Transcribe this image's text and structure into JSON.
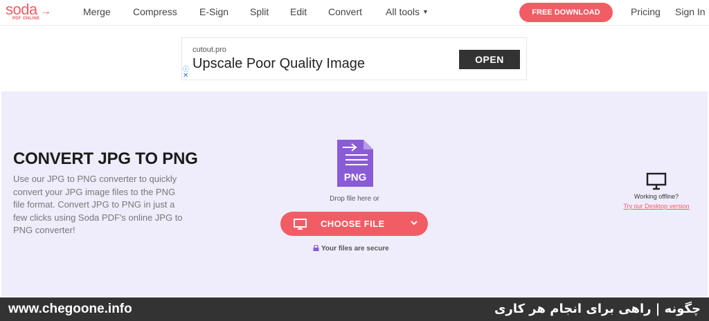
{
  "brand": {
    "logo_word": "soda",
    "logo_arrow": "→",
    "logo_sub": "PDF ONLINE",
    "accent_color": "#f25c64"
  },
  "nav": {
    "links": [
      "Merge",
      "Compress",
      "E-Sign",
      "Split",
      "Edit",
      "Convert",
      "All tools"
    ],
    "cta_label": "FREE DOWNLOAD",
    "pricing": "Pricing",
    "sign_in": "Sign In"
  },
  "ad": {
    "domain": "cutout.pro",
    "title": "Upscale Poor Quality Image",
    "button": "OPEN"
  },
  "hero": {
    "title": "CONVERT JPG TO PNG",
    "description": "Use our JPG to PNG converter to quickly convert your JPG image files to the PNG file format. Convert JPG to PNG in just a few clicks using Soda PDF's online JPG to PNG converter!",
    "file_icon_label": "PNG",
    "drop_text": "Drop file here or",
    "choose_file": "CHOOSE FILE",
    "secure_text": "Your files are secure",
    "offline_text": "Working offline?",
    "offline_link": "Try our Desktop version",
    "background_color": "#efedfc",
    "file_icon_color": "#8a5bd6"
  },
  "footer": {
    "url": "www.chegoone.info",
    "tagline": "چگونه | راهی برای انجام هر کاری"
  }
}
